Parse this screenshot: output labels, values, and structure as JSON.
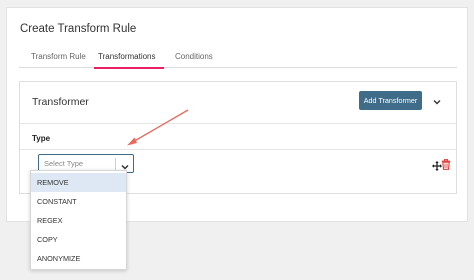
{
  "header": {
    "title": "Create Transform Rule"
  },
  "tabs": [
    {
      "label": "Transform Rule"
    },
    {
      "label": "Transformations"
    },
    {
      "label": "Conditions"
    }
  ],
  "active_tab": "Transformations",
  "transformer": {
    "title": "Transformer",
    "add_button": "Add Transformer",
    "type_label": "Type",
    "select_placeholder": "Select Type"
  },
  "dropdown": {
    "options": [
      "REMOVE",
      "CONSTANT",
      "REGEX",
      "COPY",
      "ANONYMIZE"
    ],
    "highlighted": "REMOVE"
  },
  "colors": {
    "accent": "#e91e63",
    "primary_button": "#3f6c88",
    "delete_icon": "#e53935",
    "annotation_arrow": "#e86a5d"
  },
  "icons": {
    "collapse": "chevron-down-icon",
    "select": "chevron-down-icon",
    "move": "move-icon",
    "delete": "trash-icon"
  }
}
